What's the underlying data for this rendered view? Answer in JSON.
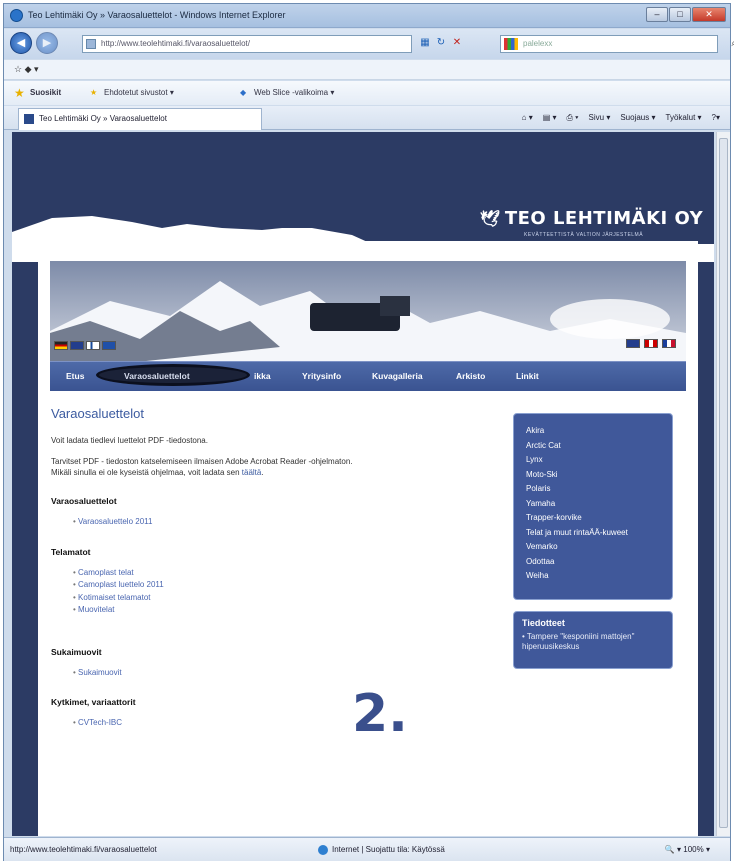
{
  "window": {
    "title": "Teo Lehtimäki Oy » Varaosaluettelot - Windows Internet Explorer",
    "buttons": {
      "minimize": "–",
      "maximize": "□",
      "close": "✕"
    }
  },
  "address_bar": {
    "url": "http://www.teolehtimaki.fi/varaosaluettelot/",
    "search_placeholder": "palelexx"
  },
  "menu": {
    "icons": "☆ ◆ ▾"
  },
  "favorites": {
    "label": "Suosikit",
    "items": [
      "Ehdotetut sivustot ▾",
      "Web Slice -valikoima ▾"
    ]
  },
  "tab": {
    "title": "Teo Lehtimäki Oy » Varaosaluettelot"
  },
  "command_bar": [
    "Sivu ▾",
    "Suojaus ▾",
    "Työkalut ▾"
  ],
  "site": {
    "brand": "TEO LEHTIMÄKI OY",
    "tagline": "KEVÄTTEETTISTÄ VALTION JÄRJESTELMÄ",
    "nav": [
      "Etus",
      "Varaosaluettelot",
      "ikka",
      "Yritysinfo",
      "Kuvagalleria",
      "Arkisto",
      "Linkit"
    ]
  },
  "main": {
    "heading": "Varaosaluettelot",
    "intro": "Voit ladata tiedlevi luettelot PDF -tiedostona.",
    "pdf_note_1": "Tarvitset PDF - tiedoston katselemiseen ilmaisen Adobe Acrobat Reader -ohjelmaton.",
    "pdf_note_2": "Mikäli sinulla ei ole kyseistä ohjelmaa, voit ladata sen",
    "pdf_link": "täältä",
    "sections": [
      {
        "title": "Varaosaluettelot",
        "items": [
          "Varaosaluettelo 2011"
        ]
      },
      {
        "title": "Telamatot",
        "items": [
          "Camoplast telat",
          "Camoplast luettelo 2011",
          "Kotimaiset telamatot",
          "Muovitelat"
        ]
      },
      {
        "title": "Sukaimuovit",
        "items": [
          "Sukaimuovit"
        ]
      },
      {
        "title": "Kytkimet, variaattorit",
        "items": [
          "CVTech-IBC"
        ]
      }
    ]
  },
  "sidebar": {
    "brands": [
      "Akira",
      "Arctic Cat",
      "Lynx",
      "Moto-Ski",
      "Polaris",
      "Yamaha",
      "Trapper-korvike",
      "Telat ja muut rintaÄÄ-kuweet",
      "Vemarko",
      "Odottaa",
      "Weiha"
    ]
  },
  "news": {
    "title": "Tiedotteet",
    "items": [
      "Tampere \"kesponiini mattojen\" hiperuusikeskus"
    ]
  },
  "annotation": {
    "text": "2."
  },
  "status_bar": {
    "url": "http://www.teolehtimaki.fi/varaosaluettelot",
    "zone": "Internet | Suojattu tila: Käytössä",
    "zoom": "100%"
  }
}
